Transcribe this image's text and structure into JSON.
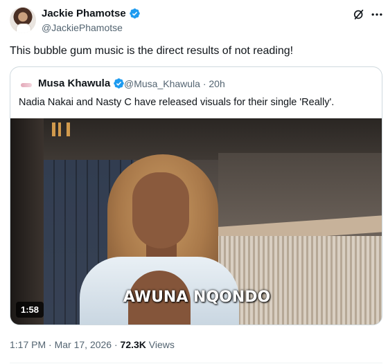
{
  "author": {
    "name": "Jackie Phamotse",
    "handle": "@JackiePhamotse",
    "verified": true
  },
  "tweet": {
    "text": "This bubble gum music is the direct results of not reading!"
  },
  "quoted": {
    "name": "Musa Khawula",
    "handle": "@Musa_Khawula",
    "separator": "·",
    "age": "20h",
    "verified": true,
    "text": "Nadia Nakai and Nasty C have released visuals for their single 'Really'.",
    "media": {
      "caption": "AWUNA NQONDO",
      "duration": "1:58"
    }
  },
  "footer": {
    "time": "1:17 PM",
    "separator": "·",
    "date": "Mar 17, 2026",
    "views_count": "72.3K",
    "views_label": "Views"
  },
  "icons": {
    "verified": "verified-badge-icon",
    "grok": "grok-icon",
    "more": "more-options-icon"
  },
  "colors": {
    "accent": "#1d9bf0",
    "text": "#0f1419",
    "secondary": "#536471",
    "border": "#cfd9de"
  }
}
